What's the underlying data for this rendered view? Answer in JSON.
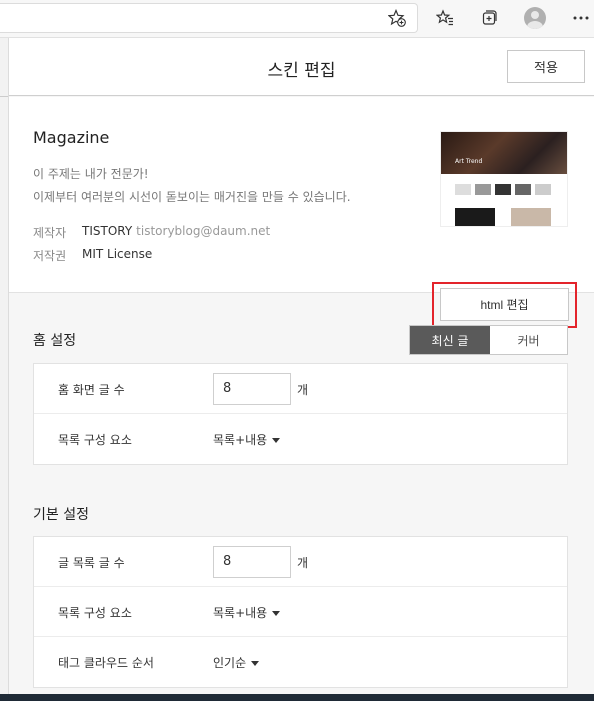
{
  "browser": {
    "icons": [
      "add-favorite-icon",
      "favorites-icon",
      "collections-icon",
      "profile-icon",
      "more-icon"
    ]
  },
  "header": {
    "title": "스킨 편집",
    "apply_label": "적용"
  },
  "skin": {
    "name": "Magazine",
    "desc_line1": "이 주제는 내가 전문가!",
    "desc_line2": "이제부터 여러분의 시선이 돋보이는 매거진을 만들 수 있습니다.",
    "maker_label": "제작자",
    "maker_name": "TISTORY",
    "maker_email": "tistoryblog@daum.net",
    "license_label": "저작권",
    "license_value": "MIT License",
    "thumbnail_caption": "Art Trend",
    "html_edit_label": "html 편집"
  },
  "home_settings": {
    "title": "홈 설정",
    "toggle": {
      "active": "최신 글",
      "inactive": "커버"
    },
    "rows": [
      {
        "label": "홈 화면 글 수",
        "value": "8",
        "unit": "개"
      },
      {
        "label": "목록 구성 요소",
        "select": "목록+내용"
      }
    ]
  },
  "basic_settings": {
    "title": "기본 설정",
    "rows": [
      {
        "label": "글 목록 글 수",
        "value": "8",
        "unit": "개"
      },
      {
        "label": "목록 구성 요소",
        "select": "목록+내용"
      },
      {
        "label": "태그 클라우드 순서",
        "select": "인기순"
      }
    ]
  },
  "colors": {
    "highlight": "#e3242b",
    "toggle_active": "#5a5a5a"
  }
}
